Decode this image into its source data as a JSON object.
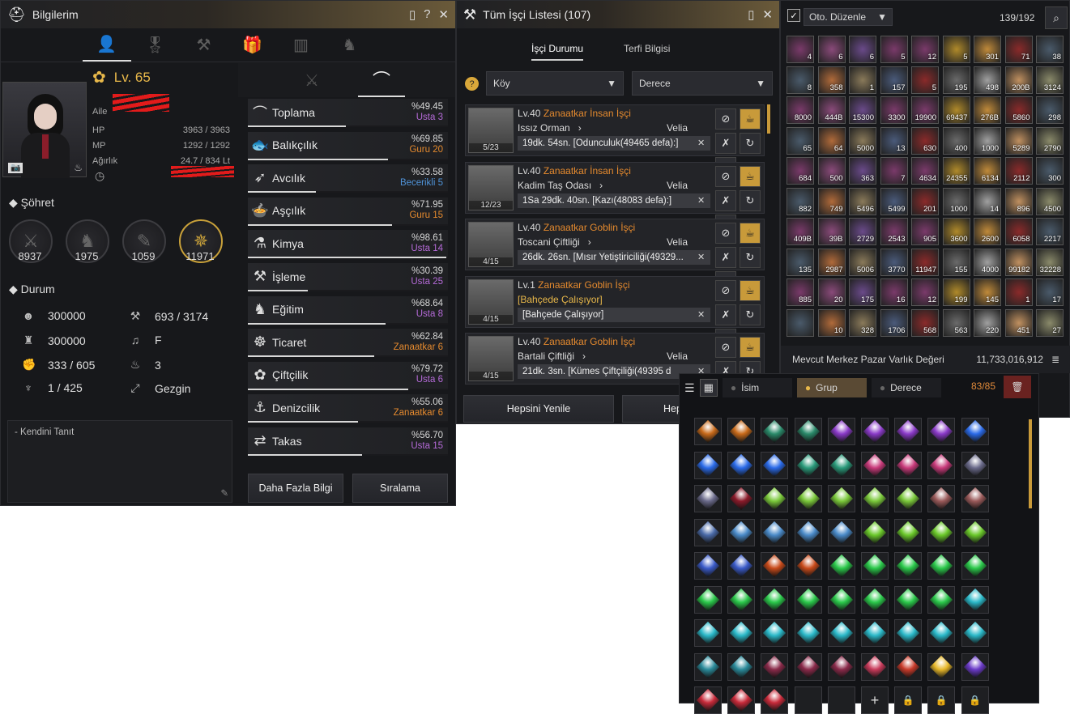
{
  "info": {
    "title": "Bilgilerim",
    "level": "Lv. 65",
    "family_label": "Aile",
    "hp_label": "HP",
    "hp": "3963 / 3963",
    "mp_label": "MP",
    "mp": "1292 / 1292",
    "weight_label": "Ağırlık",
    "weight": "24.7 / 834 Lt",
    "fame_title": "Şöhret",
    "fame": [
      "8937",
      "1975",
      "1059",
      "11971"
    ],
    "durum_title": "Durum",
    "durum_left": [
      "300000",
      "300000",
      "333 / 605",
      "1 / 425"
    ],
    "durum_right": [
      "693 / 3174",
      "F",
      "3",
      "Gezgin"
    ],
    "intro_label": "- Kendini Tanıt",
    "skills": [
      {
        "name": "Toplama",
        "pct": "%49.45",
        "rank": "Usta 3",
        "bar": 0.49
      },
      {
        "name": "Balıkçılık",
        "pct": "%69.85",
        "rank": "Guru 20",
        "bar": 0.7
      },
      {
        "name": "Avcılık",
        "pct": "%33.58",
        "rank": "Becerikli 5",
        "bar": 0.34
      },
      {
        "name": "Aşçılık",
        "pct": "%71.95",
        "rank": "Guru 15",
        "bar": 0.72
      },
      {
        "name": "Kimya",
        "pct": "%98.61",
        "rank": "Usta 14",
        "bar": 0.99
      },
      {
        "name": "İşleme",
        "pct": "%30.39",
        "rank": "Usta 25",
        "bar": 0.3
      },
      {
        "name": "Eğitim",
        "pct": "%68.64",
        "rank": "Usta 8",
        "bar": 0.69
      },
      {
        "name": "Ticaret",
        "pct": "%62.84",
        "rank": "Zanaatkar 6",
        "bar": 0.63
      },
      {
        "name": "Çiftçilik",
        "pct": "%79.72",
        "rank": "Usta 6",
        "bar": 0.8
      },
      {
        "name": "Denizcilik",
        "pct": "%55.06",
        "rank": "Zanaatkar 6",
        "bar": 0.55
      },
      {
        "name": "Takas",
        "pct": "%56.70",
        "rank": "Usta 15",
        "bar": 0.57
      }
    ],
    "more_btn": "Daha Fazla Bilgi",
    "rank_btn": "Sıralama"
  },
  "workers": {
    "title": "Tüm İşçi Listesi (107)",
    "tab1": "İşçi Durumu",
    "tab2": "Terfi Bilgisi",
    "select1": "Köy",
    "select2": "Derece",
    "list": [
      {
        "title": "Lv.40",
        "type": "Zanaatkar İnsan İşçi",
        "loc": "Issız Orman",
        "region": "Velia",
        "task": "19dk. 54sn. [Odunculuk(49465 defa):]",
        "count": "5/23"
      },
      {
        "title": "Lv.40",
        "type": "Zanaatkar İnsan İşçi",
        "loc": "Kadim Taş Odası",
        "region": "Velia",
        "task": "1Sa 29dk. 40sn. [Kazı(48083 defa):]",
        "count": "12/23"
      },
      {
        "title": "Lv.40",
        "type": "Zanaatkar Goblin İşçi",
        "loc": "Toscani Çiftliği",
        "region": "Velia",
        "task": "26dk. 26sn. [Mısır Yetiştiriciliği(49329...",
        "count": "4/15"
      },
      {
        "title": "Lv.1",
        "type": "Zanaatkar Goblin İşçi",
        "loc": "[Bahçede Çalışıyor]",
        "region": "",
        "task": "[Bahçede Çalışıyor]",
        "count": "4/15"
      },
      {
        "title": "Lv.40",
        "type": "Zanaatkar Goblin İşçi",
        "loc": "Bartali Çiftliği",
        "region": "Velia",
        "task": "21dk. 3sn. [Kümes Çiftçiliği(49395 d",
        "count": "4/15"
      }
    ],
    "refresh_btn": "Hepsini Yenile",
    "second_btn": "Hep"
  },
  "inventory": {
    "auto_label": "Oto. Düzenle",
    "capacity": "139/192",
    "market_label": "Mevcut Merkez Pazar Varlık Değeri",
    "market_value": "11,733,016,912",
    "quantities": [
      "4",
      "6",
      "6",
      "5",
      "12",
      "5",
      "301",
      "71",
      "38",
      "8",
      "358",
      "1",
      "157",
      "5",
      "195",
      "498",
      "200B",
      "3124",
      "8000",
      "444B",
      "15300",
      "3300",
      "19900",
      "69437",
      "276B",
      "5860",
      "298",
      "65",
      "64",
      "5000",
      "13",
      "630",
      "400",
      "1000",
      "5289",
      "2790",
      "684",
      "500",
      "363",
      "7",
      "4634",
      "24355",
      "6134",
      "2112",
      "300",
      "882",
      "749",
      "5496",
      "5499",
      "201",
      "1000",
      "14",
      "896",
      "4500",
      "409B",
      "39B",
      "2729",
      "2543",
      "905",
      "3600",
      "2600",
      "6058",
      "2217",
      "135",
      "2987",
      "5006",
      "3770",
      "11947",
      "155",
      "4000",
      "99182",
      "32228",
      "885",
      "20",
      "175",
      "16",
      "12",
      "199",
      "145",
      "1",
      "17",
      "",
      "10",
      "328",
      "1706",
      "568",
      "563",
      "220",
      "451",
      "27"
    ]
  },
  "storage": {
    "tab_name": "İsim",
    "tab_group": "Grup",
    "tab_grade": "Derece",
    "capacity": "83/85"
  }
}
